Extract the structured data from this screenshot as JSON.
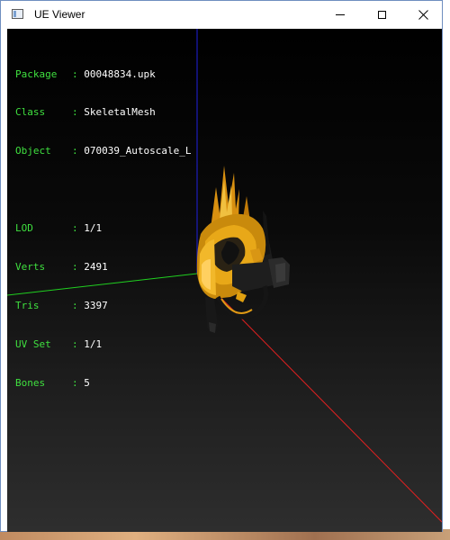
{
  "window": {
    "title": "UE Viewer"
  },
  "info_block_1": [
    {
      "label": "Package",
      "value": "00048834.upk"
    },
    {
      "label": "Class  ",
      "value": "SkeletalMesh"
    },
    {
      "label": "Object ",
      "value": "070039_Autoscale_L"
    }
  ],
  "info_block_2": [
    {
      "label": "LOD    ",
      "value": "1/1"
    },
    {
      "label": "Verts  ",
      "value": "2491"
    },
    {
      "label": "Tris   ",
      "value": "3397"
    },
    {
      "label": "UV Set ",
      "value": "1/1"
    },
    {
      "label": "Bones  ",
      "value": "5"
    }
  ],
  "colors": {
    "label": "#3fe03f",
    "value": "#ffffff",
    "axis_x": "#e02020",
    "axis_y": "#20d020",
    "axis_z": "#2020e0",
    "model": "#e8a010"
  }
}
